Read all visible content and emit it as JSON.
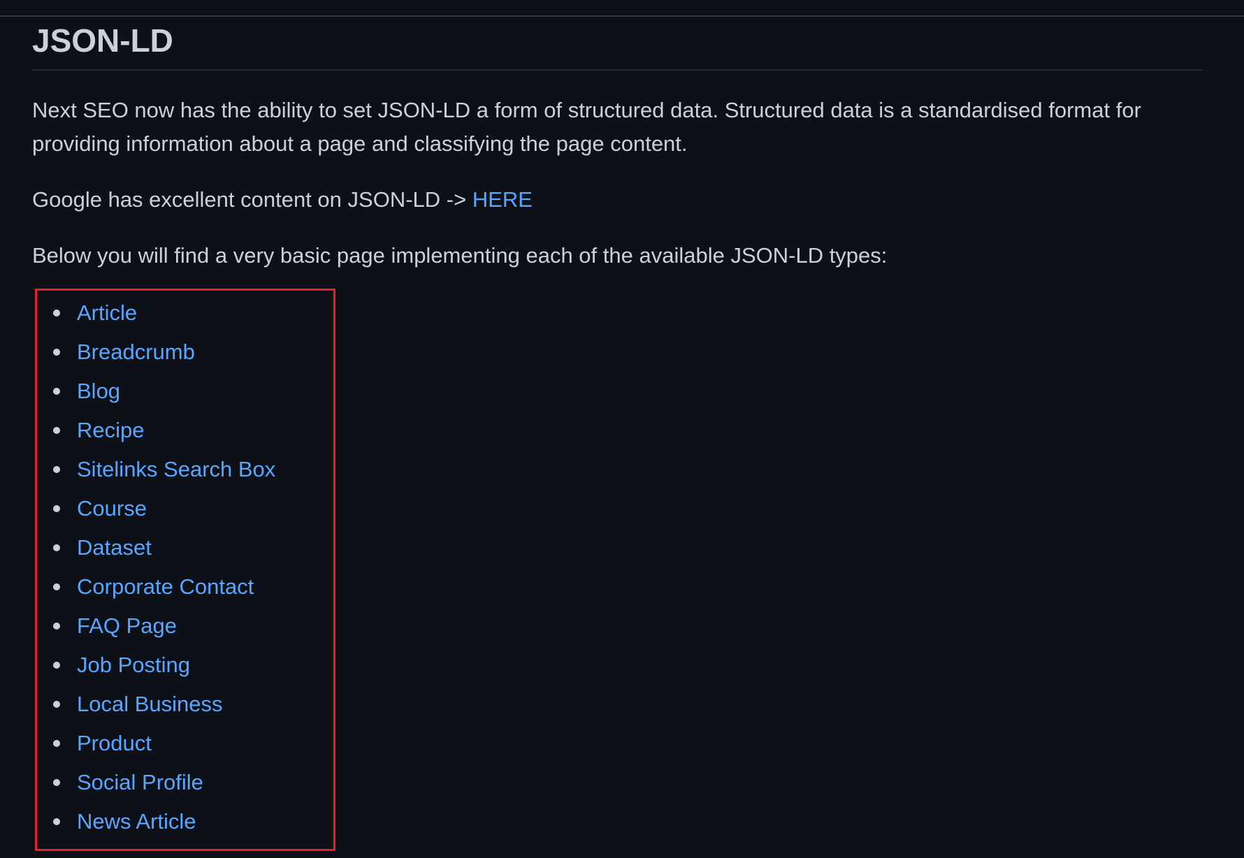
{
  "section": {
    "title": "JSON-LD"
  },
  "paragraphs": {
    "intro": "Next SEO now has the ability to set JSON-LD a form of structured data. Structured data is a standardised format for providing information about a page and classifying the page content.",
    "google_prefix": "Google has excellent content on JSON-LD -> ",
    "google_link": "HERE",
    "below": "Below you will find a very basic page implementing each of the available JSON-LD types:"
  },
  "types": [
    "Article",
    "Breadcrumb",
    "Blog",
    "Recipe",
    "Sitelinks Search Box",
    "Course",
    "Dataset",
    "Corporate Contact",
    "FAQ Page",
    "Job Posting",
    "Local Business",
    "Product",
    "Social Profile",
    "News Article"
  ],
  "colors": {
    "background": "#0d1117",
    "text": "#c9d1d9",
    "link": "#58a6ff",
    "highlight_border": "#e5212a"
  }
}
